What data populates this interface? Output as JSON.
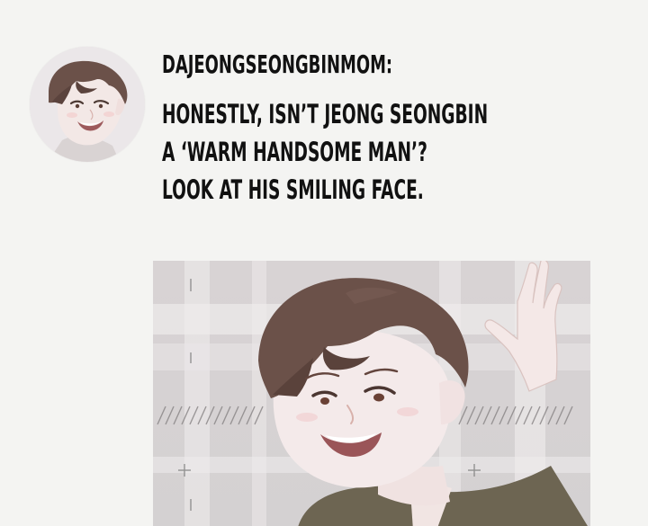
{
  "post": {
    "username": "DAJEONGSEONGBINMOM:",
    "lines": [
      "HONESTLY, ISN’T JEONG SEONGBIN",
      "A ‘WARM HANDSOME MAN’?",
      "LOOK AT HIS SMILING FACE."
    ]
  },
  "colors": {
    "background": "#f4f4f2",
    "text": "#111111",
    "hair": "#6b5149",
    "skin": "#f2e7e5"
  },
  "images": {
    "avatar": "avatar-illustration",
    "panel": "manhwa-panel-illustration"
  }
}
